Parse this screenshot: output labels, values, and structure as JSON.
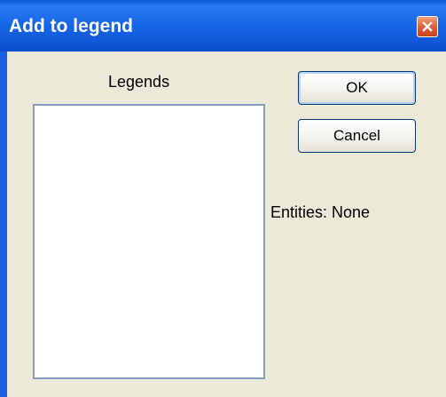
{
  "window": {
    "title": "Add to legend"
  },
  "dialog": {
    "legends_label": "Legends",
    "ok_label": "OK",
    "cancel_label": "Cancel",
    "entities_text": "Entities:  None"
  },
  "icons": {
    "close": "close-icon"
  },
  "colors": {
    "titlebar_blue": "#0b56d6",
    "dialog_background": "#ece9d8",
    "list_border": "#7f9db9",
    "close_button": "#e0653c"
  }
}
